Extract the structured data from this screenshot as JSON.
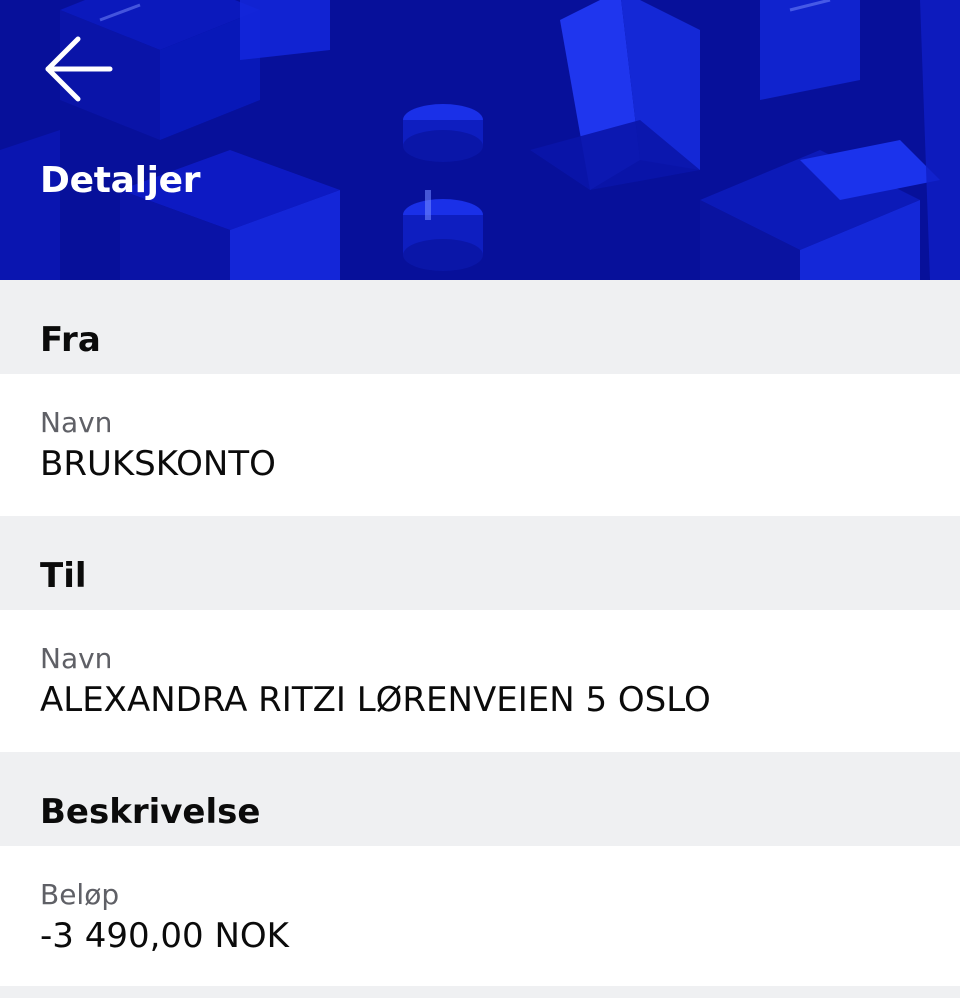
{
  "header": {
    "title": "Detaljer",
    "back_icon": "arrow-left-icon",
    "background_color": "#07109a"
  },
  "sections": [
    {
      "title": "Fra",
      "label": "Navn",
      "value": "BRUKSKONTO"
    },
    {
      "title": "Til",
      "label": "Navn",
      "value": "ALEXANDRA RITZI LØRENVEIEN 5 OSLO"
    },
    {
      "title": "Beskrivelse",
      "label": "Beløp",
      "value": "-3 490,00 NOK"
    }
  ],
  "colors": {
    "section_background": "#eff0f2",
    "label_text": "#5f6066",
    "value_text": "#0b0b0b"
  }
}
